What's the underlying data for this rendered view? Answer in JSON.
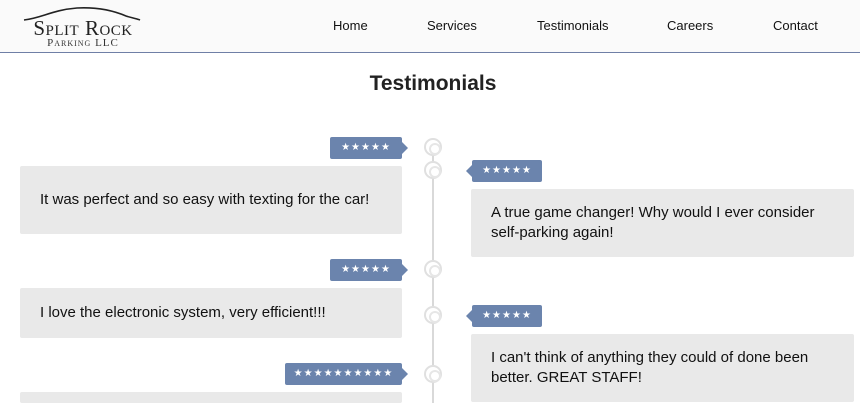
{
  "brand": {
    "name": "Split Rock",
    "subtitle": "Parking LLC"
  },
  "nav": {
    "items": [
      {
        "label": "Home"
      },
      {
        "label": "Services"
      },
      {
        "label": "Testimonials"
      },
      {
        "label": "Careers"
      },
      {
        "label": "Contact"
      }
    ]
  },
  "page": {
    "title": "Testimonials"
  },
  "testimonials": [
    {
      "side": "left",
      "stars": "★★★★★",
      "text": "It was perfect and so easy with texting for the car!"
    },
    {
      "side": "right",
      "stars": "★★★★★",
      "text": "A true game changer! Why would I ever consider self-parking again!"
    },
    {
      "side": "left",
      "stars": "★★★★★",
      "text": "I love the electronic system, very efficient!!!"
    },
    {
      "side": "right",
      "stars": "★★★★★",
      "text": "I can't think of anything they could of done been better. GREAT STAFF!"
    },
    {
      "side": "left",
      "stars": "★★★★★★★★★★",
      "text": ""
    }
  ],
  "colors": {
    "accent": "#6b84ad",
    "card_bg": "#e9e9e9",
    "header_border": "#6f7fa6"
  },
  "icons": {
    "timeline_marker": "clock-icon"
  }
}
